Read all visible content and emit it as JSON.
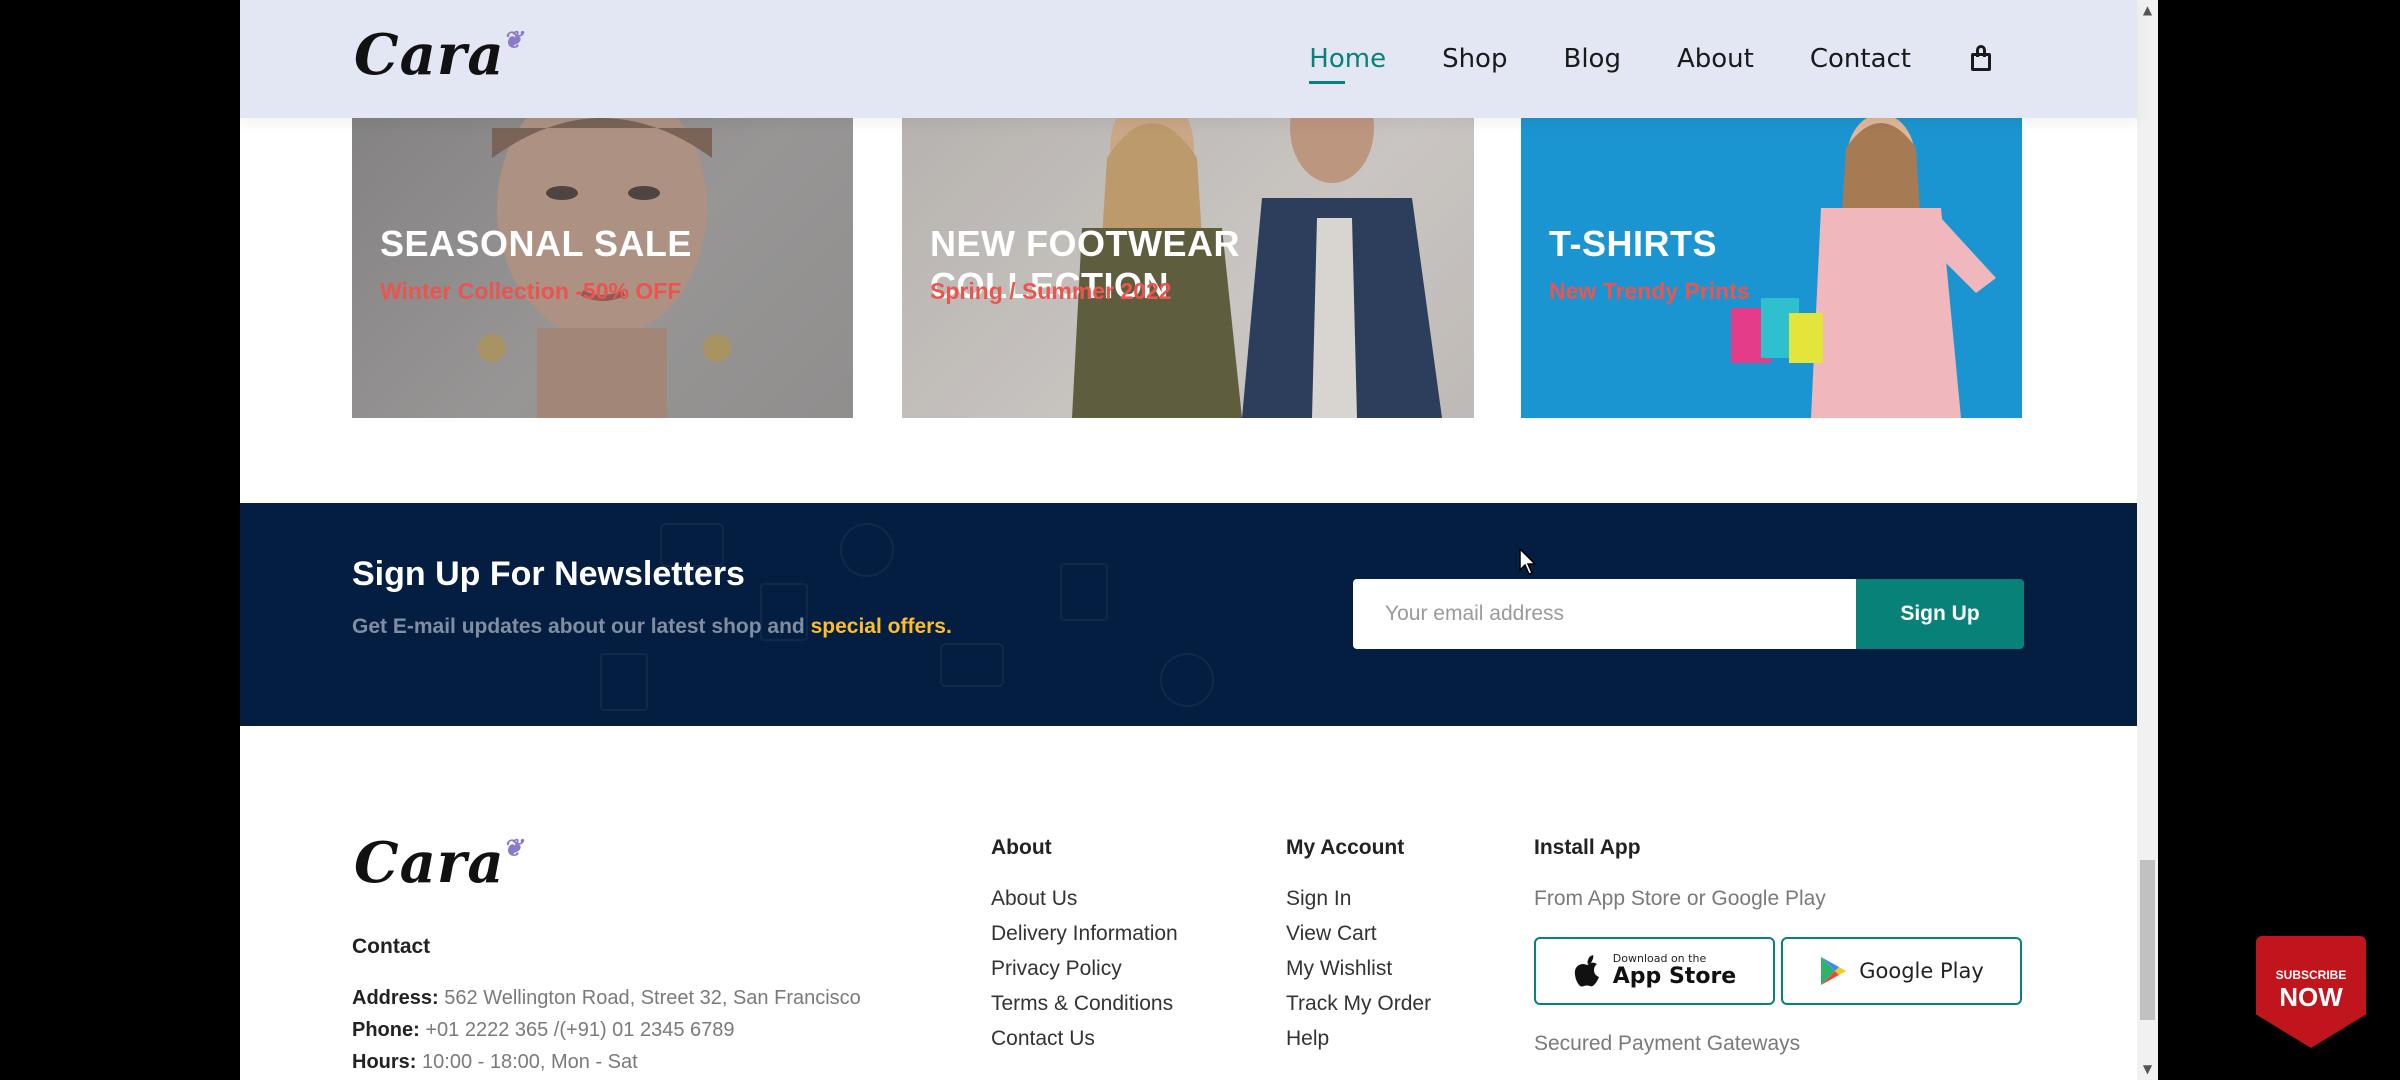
{
  "header": {
    "logo": "Cara",
    "nav": [
      "Home",
      "Shop",
      "Blog",
      "About",
      "Contact"
    ],
    "active_nav": "Home",
    "cart_icon": "shopping-bag-icon"
  },
  "banners": [
    {
      "title": "SEASONAL SALE",
      "subtitle": "Winter Collection -50% OFF"
    },
    {
      "title": "NEW FOOTWEAR COLLECTION",
      "subtitle": "Spring / Summer 2022"
    },
    {
      "title": "T-SHIRTS",
      "subtitle": "New Trendy Prints"
    }
  ],
  "newsletter": {
    "title": "Sign Up For Newsletters",
    "subtitle_prefix": "Get E-mail updates about our latest shop and",
    "subtitle_highlight": "special offers.",
    "email_placeholder": "Your email address",
    "button_label": "Sign Up"
  },
  "footer": {
    "logo": "Cara",
    "contact": {
      "heading": "Contact",
      "address_label": "Address:",
      "address_value": "562 Wellington Road, Street 32, San Francisco",
      "phone_label": "Phone:",
      "phone_value": "+01 2222 365 /(+91) 01 2345 6789",
      "hours_label": "Hours:",
      "hours_value": "10:00 - 18:00, Mon - Sat"
    },
    "about": {
      "heading": "About",
      "links": [
        "About Us",
        "Delivery Information",
        "Privacy Policy",
        "Terms & Conditions",
        "Contact Us"
      ]
    },
    "account": {
      "heading": "My Account",
      "links": [
        "Sign In",
        "View Cart",
        "My Wishlist",
        "Track My Order",
        "Help"
      ]
    },
    "install": {
      "heading": "Install App",
      "subtitle": "From App Store or Google Play",
      "app_store_small": "Download on the",
      "app_store_big": "App Store",
      "google_play": "Google Play",
      "payments": "Secured Payment Gateways"
    }
  },
  "overlay": {
    "subscribe_small": "SUBSCRIBE",
    "subscribe_big": "NOW"
  },
  "colors": {
    "accent": "#088178",
    "header_bg": "#e3e6f3",
    "newsletter_bg": "#041e42",
    "highlight": "#ffbd27",
    "banner_subtitle": "#ec544e"
  }
}
